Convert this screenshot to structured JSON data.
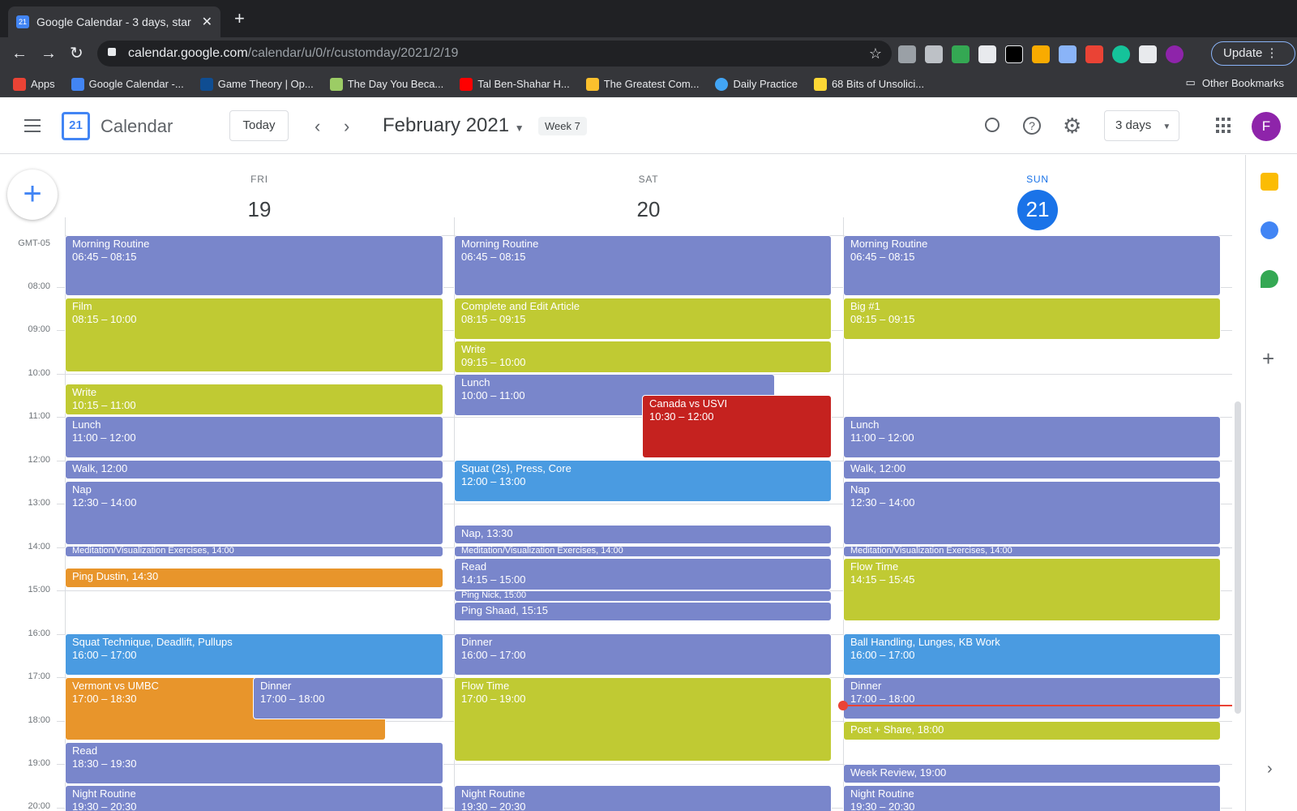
{
  "browser": {
    "tab_title": "Google Calendar - 3 days, star",
    "tab_favicon": "21",
    "url_host": "calendar.google.com",
    "url_path": "/calendar/u/0/r/customday/2021/2/19",
    "update_label": "Update",
    "bookmarks": [
      {
        "label": "Apps",
        "color": "#ea4335"
      },
      {
        "label": "Google Calendar -...",
        "color": "#4285f4"
      },
      {
        "label": "Game Theory | Op...",
        "color": "#0f4d92"
      },
      {
        "label": "The Day You Beca...",
        "color": "#9ccc65"
      },
      {
        "label": "Tal Ben-Shahar H...",
        "color": "#ff0000"
      },
      {
        "label": "The Greatest Com...",
        "color": "#fbc02d"
      },
      {
        "label": "Daily Practice",
        "color": "#42a5f5"
      },
      {
        "label": "68 Bits of Unsolici...",
        "color": "#fdd835"
      }
    ],
    "other_bookmarks": "Other Bookmarks"
  },
  "header": {
    "logo_day": "21",
    "app_title": "Calendar",
    "today_label": "Today",
    "month_label": "February 2021",
    "week_label": "Week 7",
    "view_label": "3 days",
    "avatar_letter": "F"
  },
  "days": [
    {
      "name": "FRI",
      "num": "19"
    },
    {
      "name": "SAT",
      "num": "20"
    },
    {
      "name": "SUN",
      "num": "21"
    }
  ],
  "timezone": "GMT-05",
  "hours": [
    "08:00",
    "09:00",
    "10:00",
    "11:00",
    "12:00",
    "13:00",
    "14:00",
    "15:00",
    "16:00",
    "17:00",
    "18:00",
    "19:00",
    "20:00"
  ],
  "events": {
    "fri": [
      {
        "title": "Morning Routine",
        "time": "06:45 – 08:15"
      },
      {
        "title": "Film",
        "time": "08:15 – 10:00"
      },
      {
        "title": "Write",
        "time": "10:15 – 11:00"
      },
      {
        "title": "Lunch",
        "time": "11:00 – 12:00"
      },
      {
        "title": "Walk",
        "time": "12:00"
      },
      {
        "title": "Nap",
        "time": "12:30 – 14:00"
      },
      {
        "title": "Meditation/Visualization Exercises",
        "time": "14:00"
      },
      {
        "title": "Ping Dustin",
        "time": "14:30"
      },
      {
        "title": "Squat Technique, Deadlift, Pullups",
        "time": "16:00 – 17:00"
      },
      {
        "title": "Vermont vs UMBC",
        "time": "17:00 – 18:30"
      },
      {
        "title": "Dinner",
        "time": "17:00 – 18:00"
      },
      {
        "title": "Read",
        "time": "18:30 – 19:30"
      },
      {
        "title": "Night Routine",
        "time": "19:30 – 20:30"
      }
    ],
    "sat": [
      {
        "title": "Morning Routine",
        "time": "06:45 – 08:15"
      },
      {
        "title": "Complete and Edit Article",
        "time": "08:15 – 09:15"
      },
      {
        "title": "Write",
        "time": "09:15 – 10:00"
      },
      {
        "title": "Lunch",
        "time": "10:00 – 11:00"
      },
      {
        "title": "Canada vs USVI",
        "time": "10:30 – 12:00"
      },
      {
        "title": "Squat (2s), Press, Core",
        "time": "12:00 – 13:00"
      },
      {
        "title": "Nap",
        "time": "13:30"
      },
      {
        "title": "Meditation/Visualization Exercises",
        "time": "14:00"
      },
      {
        "title": "Read",
        "time": "14:15 – 15:00"
      },
      {
        "title": "Ping Nick",
        "time": "15:00"
      },
      {
        "title": "Ping Shaad",
        "time": "15:15"
      },
      {
        "title": "Dinner",
        "time": "16:00 – 17:00"
      },
      {
        "title": "Flow Time",
        "time": "17:00 – 19:00"
      },
      {
        "title": "Night Routine",
        "time": "19:30 – 20:30"
      }
    ],
    "sun": [
      {
        "title": "Morning Routine",
        "time": "06:45 – 08:15"
      },
      {
        "title": "Big #1",
        "time": "08:15 – 09:15"
      },
      {
        "title": "Lunch",
        "time": "11:00 – 12:00"
      },
      {
        "title": "Walk",
        "time": "12:00"
      },
      {
        "title": "Nap",
        "time": "12:30 – 14:00"
      },
      {
        "title": "Meditation/Visualization Exercises",
        "time": "14:00"
      },
      {
        "title": "Flow Time",
        "time": "14:15 – 15:45"
      },
      {
        "title": "Ball Handling, Lunges, KB Work",
        "time": "16:00 – 17:00"
      },
      {
        "title": "Dinner",
        "time": "17:00 – 18:00"
      },
      {
        "title": "Post + Share",
        "time": "18:00"
      },
      {
        "title": "Week Review",
        "time": "19:00"
      },
      {
        "title": "Night Routine",
        "time": "19:30 – 20:30"
      }
    ]
  },
  "colors": {
    "lavender": "#7986cb",
    "olive": "#c0ca33",
    "blue": "#4a9be1",
    "orange": "#e8952b",
    "red": "#c5221f",
    "today": "#1a73e8"
  }
}
